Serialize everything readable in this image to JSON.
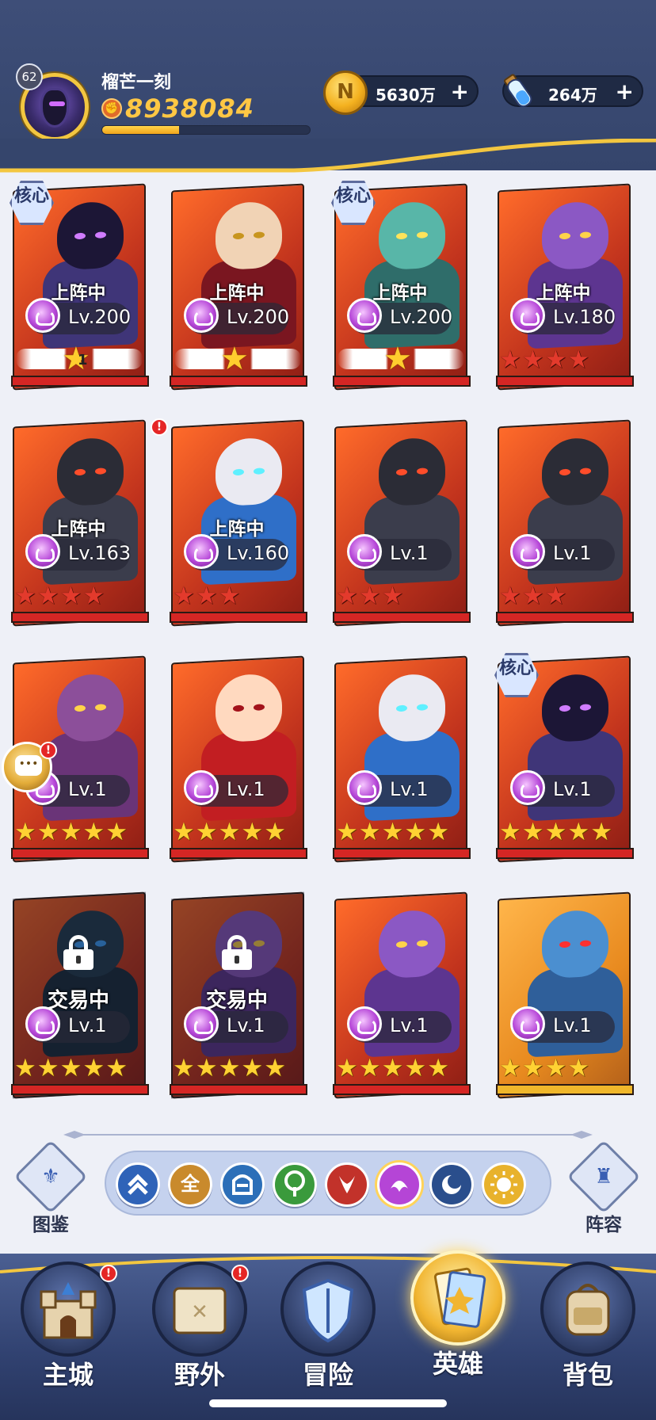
{
  "player": {
    "level": "62",
    "name": "榴芒一刻",
    "power": "8938084",
    "exp_fraction": 0.37
  },
  "resources": {
    "gold": "5630万",
    "potion": "264万",
    "plus": "+"
  },
  "colors": {
    "accent_gold": "#f3c640",
    "card_red": "#d52624",
    "card_gold": "#f0b72b",
    "header_bg": "#3e4e78"
  },
  "heroes": [
    {
      "core": "核心",
      "status": "上阵中",
      "level": "Lv.200",
      "stars": "wing",
      "star_count": "1",
      "art": "reaper"
    },
    {
      "core": "",
      "status": "上阵中",
      "level": "Lv.200",
      "stars": "wing",
      "art": "vampire"
    },
    {
      "core": "核心",
      "status": "上阵中",
      "level": "Lv.200",
      "stars": "wing",
      "art": "troll"
    },
    {
      "core": "",
      "status": "上阵中",
      "level": "Lv.180",
      "stars": "4red",
      "art": "ogre"
    },
    {
      "core": "",
      "status": "上阵中",
      "level": "Lv.163",
      "stars": "4red",
      "art": "dark-knight",
      "alert": "!"
    },
    {
      "core": "",
      "status": "上阵中",
      "level": "Lv.160",
      "stars": "3red",
      "art": "skull-wizard"
    },
    {
      "core": "",
      "status": "",
      "level": "Lv.1",
      "stars": "3red",
      "art": "dark-knight"
    },
    {
      "core": "",
      "status": "",
      "level": "Lv.1",
      "stars": "3red",
      "art": "dark-knight"
    },
    {
      "core": "",
      "status": "",
      "level": "Lv.1",
      "stars": "5gold",
      "art": "demon",
      "chat": true
    },
    {
      "core": "",
      "status": "",
      "level": "Lv.1",
      "stars": "5gold",
      "art": "fire-girl"
    },
    {
      "core": "",
      "status": "",
      "level": "Lv.1",
      "stars": "5gold",
      "art": "skull-wizard"
    },
    {
      "core": "核心",
      "status": "",
      "level": "Lv.1",
      "stars": "5gold",
      "art": "reaper"
    },
    {
      "core": "",
      "status": "交易中",
      "level": "Lv.1",
      "stars": "5gold",
      "art": "shadow-beast",
      "locked": true
    },
    {
      "core": "",
      "status": "交易中",
      "level": "Lv.1",
      "stars": "5gold",
      "art": "ogre",
      "locked": true
    },
    {
      "core": "",
      "status": "",
      "level": "Lv.1",
      "stars": "5gold",
      "art": "ogre"
    },
    {
      "core": "",
      "status": "",
      "level": "Lv.1",
      "stars": "4gold",
      "art": "blue-orc",
      "gold_card": true
    }
  ],
  "filters": {
    "all_label": "全",
    "icons": [
      "collapse-icon",
      "all-icon",
      "helmet-icon",
      "nature-icon",
      "fire-icon",
      "shadow-icon",
      "moon-icon",
      "sun-icon"
    ]
  },
  "side": {
    "codex_label": "图鉴",
    "lineup_label": "阵容"
  },
  "nav": {
    "items": [
      {
        "label": "主城",
        "icon": "castle-icon",
        "alert": "!"
      },
      {
        "label": "野外",
        "icon": "map-scroll-icon",
        "alert": "!"
      },
      {
        "label": "冒险",
        "icon": "shield-icon"
      },
      {
        "label": "英雄",
        "icon": "hero-card-icon",
        "active": true
      },
      {
        "label": "背包",
        "icon": "backpack-icon"
      }
    ]
  }
}
